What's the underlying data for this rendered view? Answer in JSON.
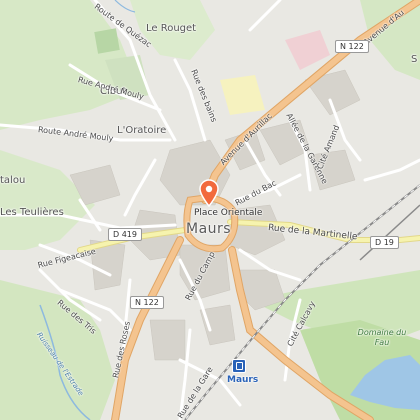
{
  "map": {
    "town": "Maurs",
    "poi": "Place Orientale",
    "station": "Maurs",
    "places": [
      "Le Rouget",
      "Cibut",
      "L'Oratoire",
      "Les Teulières",
      "talou",
      "S"
    ],
    "streets": {
      "quezac": "Route de Quézac",
      "mouly1": "Rue André Mouly",
      "mouly2": "Route André Mouly",
      "bains": "Rue des bains",
      "aurillac1": "Avenue d'Aurillac",
      "aurillac2": "Avenue d'Au",
      "garenne": "Allée de la Garenne",
      "amand": "Cité Amand",
      "bac": "Rue du Bac",
      "martinelle": "Rue de la Martinelle",
      "figeac": "Rue Figeacaise",
      "camp": "Rue du Camp",
      "tris": "Rue des Tris",
      "roses": "Rue des Roses",
      "gare": "Rue de la Gare",
      "calcavy": "Cité Calcavy",
      "estrade": "Ruisseau de l'Estrade"
    },
    "roads": [
      "N 122",
      "N 122",
      "D 419",
      "D 19"
    ],
    "green": "Domaine du Fau",
    "colors": {
      "pin": "#f26a3d",
      "station": "#2a63b8",
      "road_primary": "#f3c48f",
      "road_secondary": "#f6f7b4",
      "park": "#c8e3b0",
      "water": "#a8c8e8"
    }
  }
}
